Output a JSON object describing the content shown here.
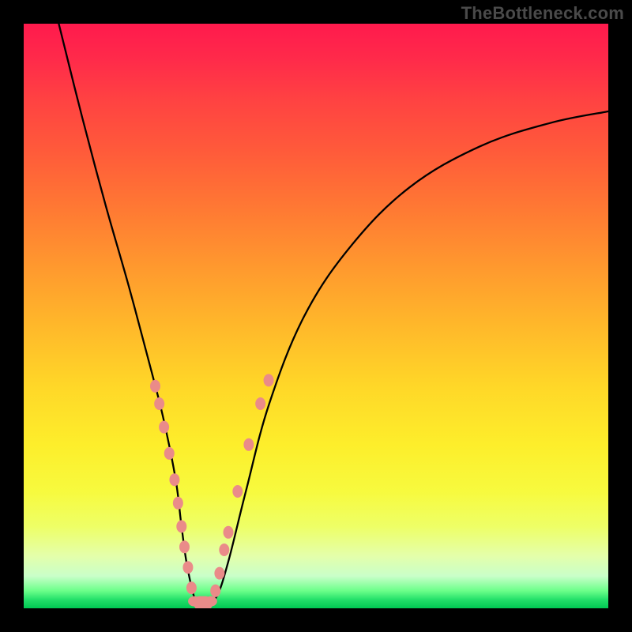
{
  "watermark": "TheBottleneck.com",
  "chart_data": {
    "type": "line",
    "title": "",
    "xlabel": "",
    "ylabel": "",
    "xlim": [
      0,
      100
    ],
    "ylim": [
      0,
      100
    ],
    "grid": false,
    "legend": false,
    "series": [
      {
        "name": "bottleneck-curve",
        "x": [
          6,
          10,
          14,
          18,
          22,
          24,
          26,
          27,
          28,
          29.5,
          31,
          33,
          35,
          38,
          42,
          48,
          56,
          66,
          78,
          90,
          100
        ],
        "y": [
          100,
          84,
          69,
          55,
          40,
          32,
          22,
          14,
          7,
          1,
          0.5,
          2,
          8,
          20,
          35,
          50,
          62,
          72,
          79,
          83,
          85
        ]
      }
    ],
    "markers": {
      "left_branch": [
        {
          "x": 22.5,
          "y": 38
        },
        {
          "x": 23.2,
          "y": 35
        },
        {
          "x": 24.0,
          "y": 31
        },
        {
          "x": 24.9,
          "y": 26.5
        },
        {
          "x": 25.8,
          "y": 22
        },
        {
          "x": 26.4,
          "y": 18
        },
        {
          "x": 27.0,
          "y": 14
        },
        {
          "x": 27.5,
          "y": 10.5
        },
        {
          "x": 28.1,
          "y": 7
        },
        {
          "x": 28.7,
          "y": 3.5
        }
      ],
      "flat_bottom": [
        {
          "x": 29.2,
          "y": 1.2
        },
        {
          "x": 30.2,
          "y": 0.6
        },
        {
          "x": 31.2,
          "y": 0.6
        },
        {
          "x": 32.0,
          "y": 1.2
        }
      ],
      "right_branch": [
        {
          "x": 32.8,
          "y": 3
        },
        {
          "x": 33.5,
          "y": 6
        },
        {
          "x": 34.3,
          "y": 10
        },
        {
          "x": 35.0,
          "y": 13
        },
        {
          "x": 36.6,
          "y": 20
        },
        {
          "x": 38.5,
          "y": 28
        },
        {
          "x": 40.5,
          "y": 35
        },
        {
          "x": 41.9,
          "y": 39
        }
      ]
    },
    "background_gradient": {
      "top": "#ff1a4d",
      "mid": "#ffd728",
      "bottom": "#00c853"
    }
  }
}
